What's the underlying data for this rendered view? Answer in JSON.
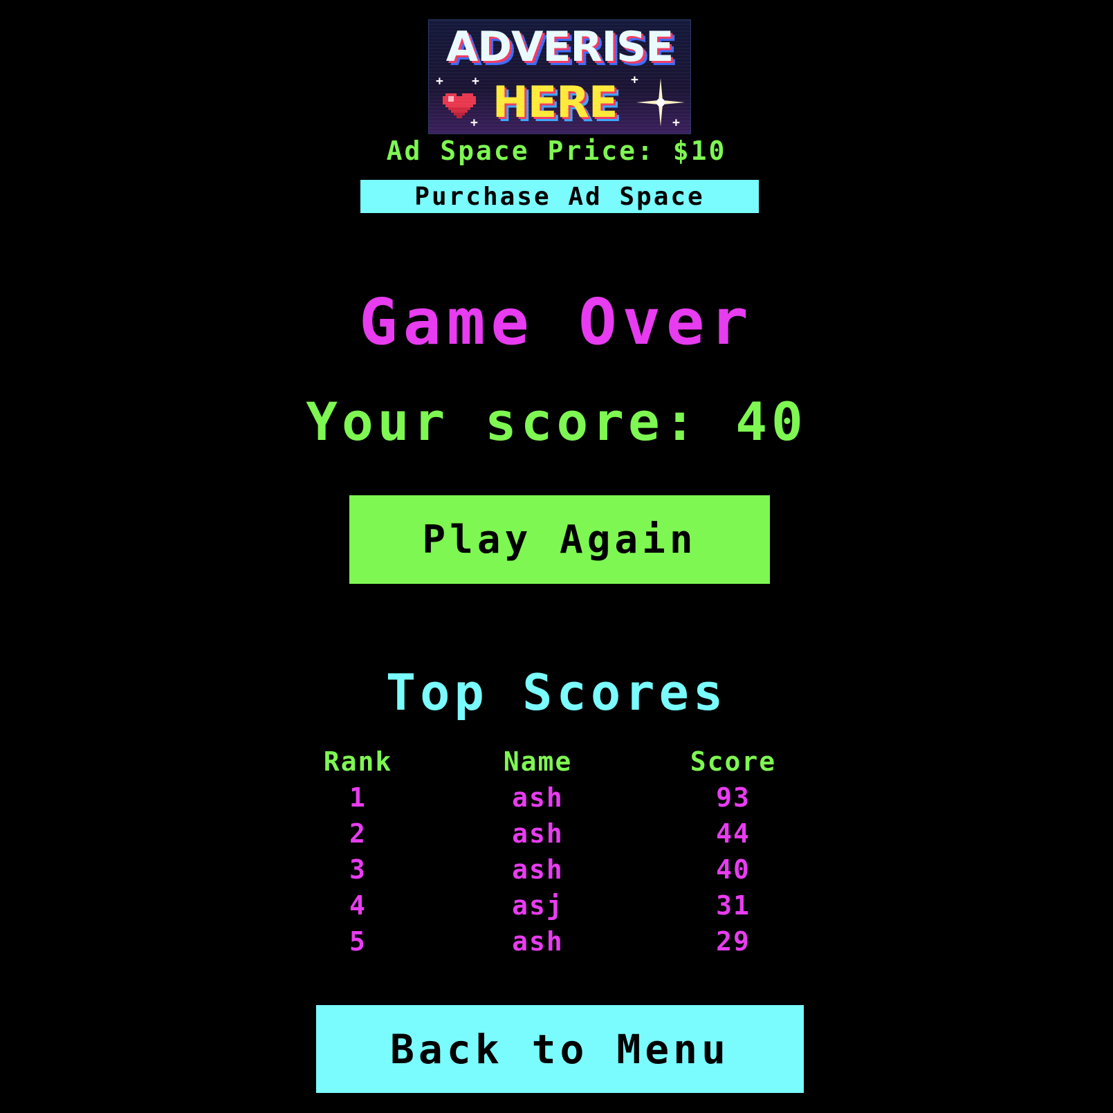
{
  "ad": {
    "banner_line1": "ADVERISE",
    "banner_line2": "HERE",
    "price_label": "Ad Space Price: $10",
    "purchase_label": "Purchase Ad Space"
  },
  "game": {
    "title": "Game Over",
    "score_label": "Your score: 40",
    "score_value": 40,
    "play_again_label": "Play Again"
  },
  "leaderboard": {
    "title": "Top Scores",
    "headers": [
      "Rank",
      "Name",
      "Score"
    ],
    "rows": [
      {
        "rank": "1",
        "name": "ash",
        "score": "93"
      },
      {
        "rank": "2",
        "name": "ash",
        "score": "44"
      },
      {
        "rank": "3",
        "name": "ash",
        "score": "40"
      },
      {
        "rank": "4",
        "name": "asj",
        "score": "31"
      },
      {
        "rank": "5",
        "name": "ash",
        "score": "29"
      }
    ]
  },
  "nav": {
    "back_label": "Back to Menu"
  },
  "colors": {
    "background": "#000000",
    "green": "#7ef752",
    "magenta": "#e83cf0",
    "cyan": "#7afcff"
  }
}
